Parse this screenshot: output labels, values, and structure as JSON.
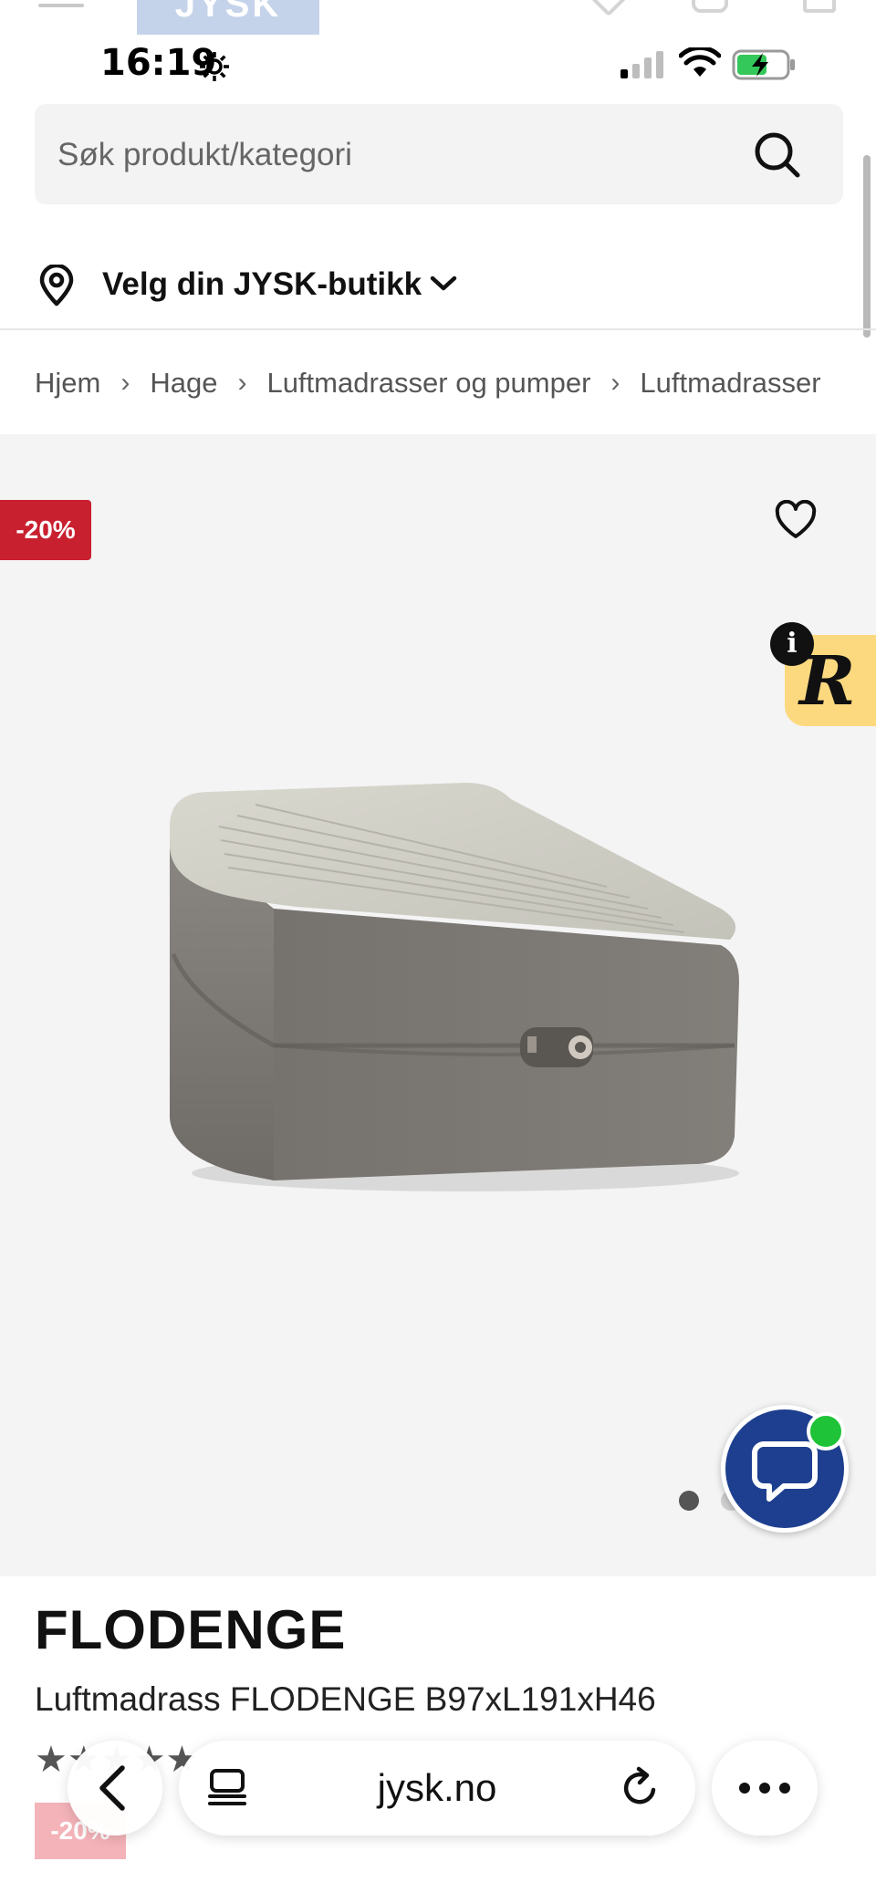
{
  "status_bar": {
    "time": "16:19"
  },
  "search": {
    "placeholder": "Søk produkt/kategori"
  },
  "store_selector": {
    "label": "Velg din JYSK-butikk"
  },
  "breadcrumb": {
    "items": [
      "Hjem",
      "Hage",
      "Luftmadrasser og pumper",
      "Luftmadrasser"
    ],
    "separator": "›"
  },
  "gallery": {
    "discount_badge": "-20%",
    "review_widget_letter": "R",
    "review_info_glyph": "i",
    "total_images": 2,
    "active_image": 1
  },
  "product": {
    "name": "FLODENGE",
    "description": "Luftmadrass FLODENGE B97xL191xH46",
    "rating": "★★★★★",
    "price_badge": "-20%"
  },
  "browser": {
    "url": "jysk.no"
  },
  "colors": {
    "discount_red": "#c8202f",
    "chat_blue": "#1e3f8f",
    "online_green": "#1ec337",
    "review_yellow": "#fcd97f",
    "gallery_bg": "#f4f4f4"
  },
  "icons": [
    "menu-icon",
    "jysk-logo",
    "heart-icon",
    "user-icon",
    "cart-icon",
    "settings-icon",
    "cellular-icon",
    "wifi-icon",
    "battery-icon",
    "search-icon",
    "location-pin-icon",
    "chevron-down-icon",
    "chat-icon",
    "back-icon",
    "tabs-icon",
    "reload-icon",
    "more-icon"
  ]
}
